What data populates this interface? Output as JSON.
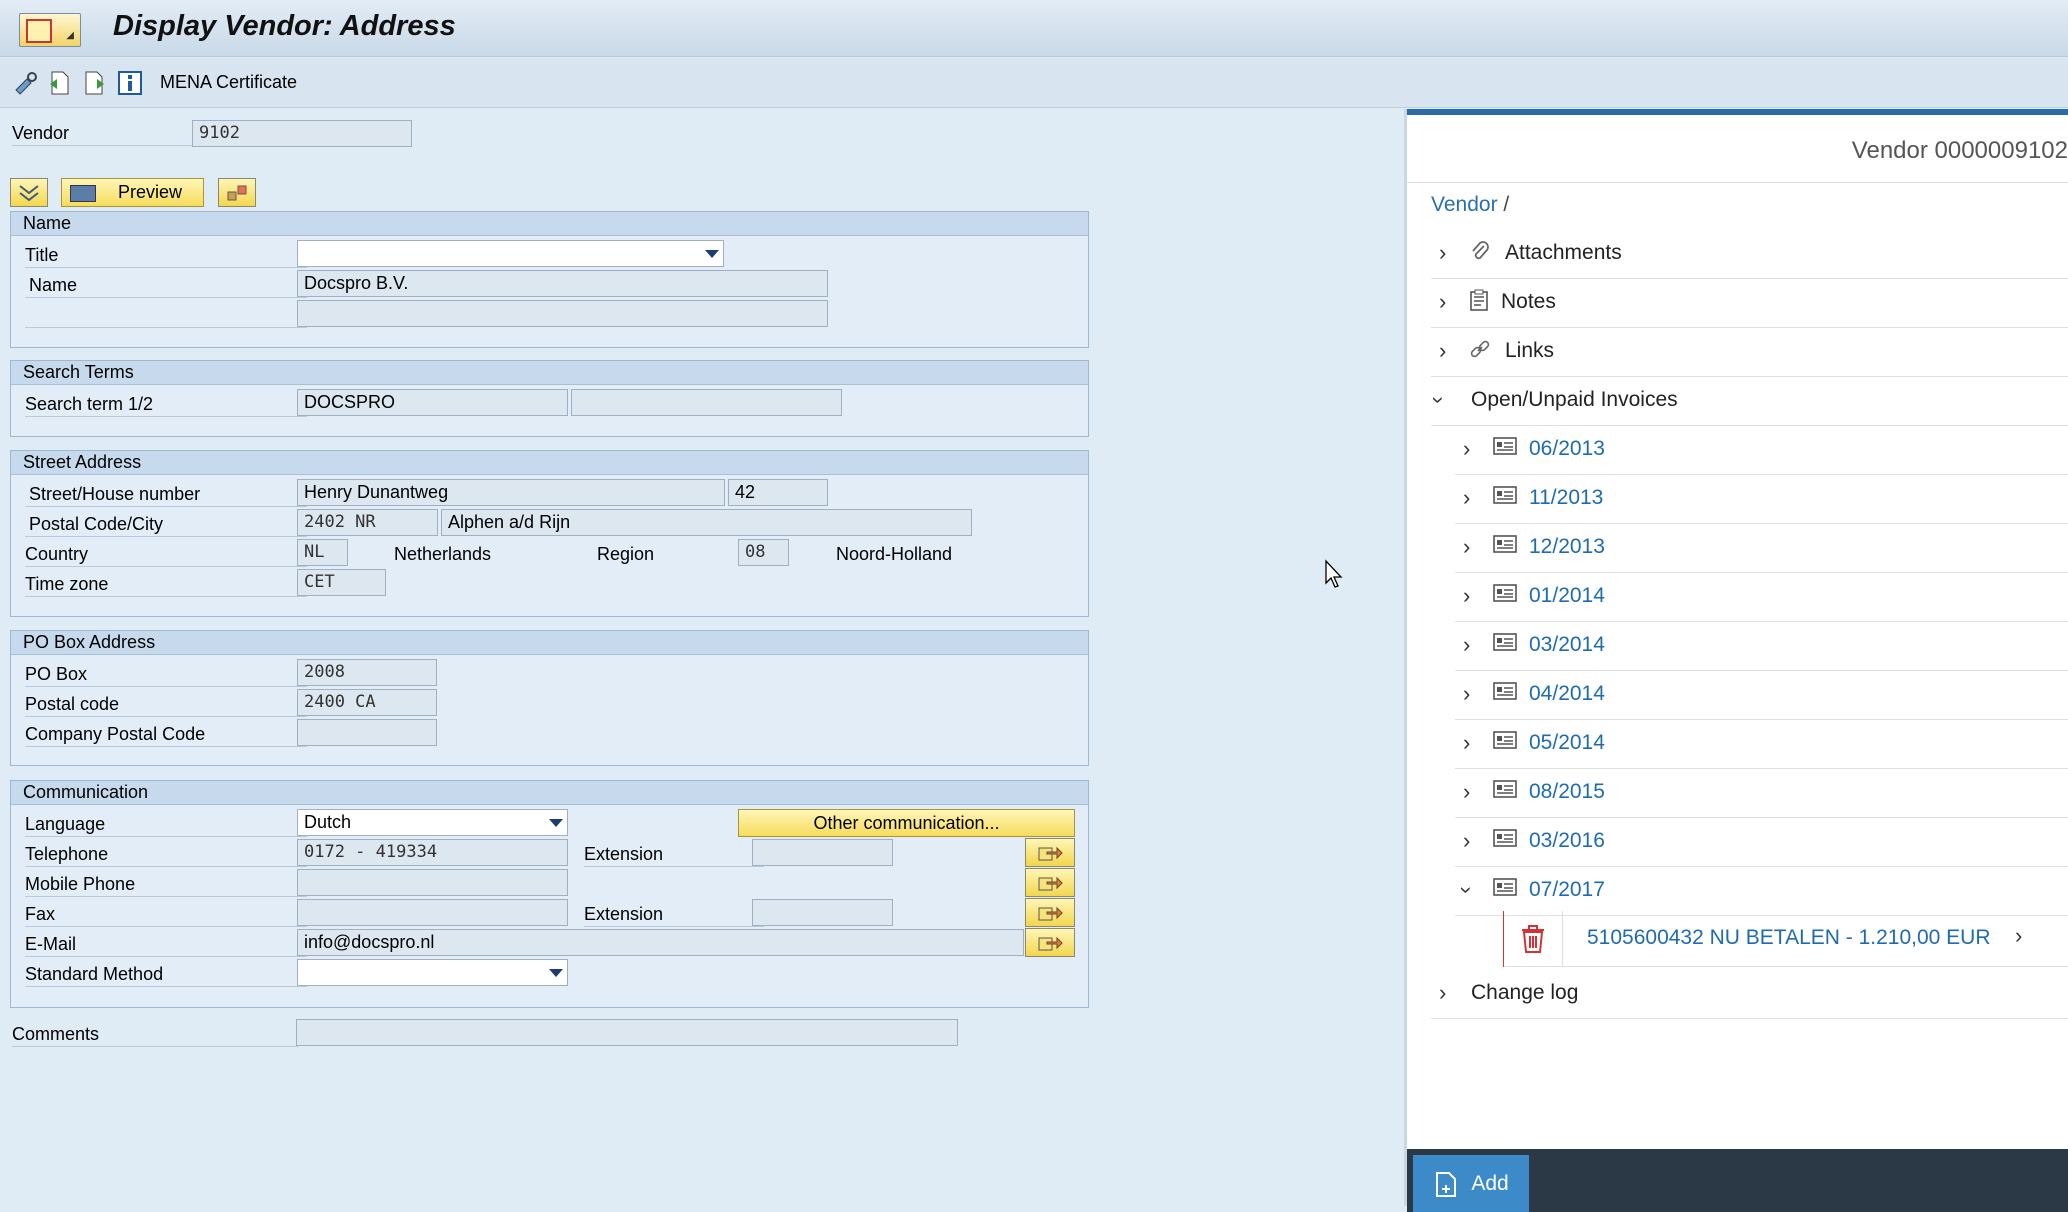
{
  "window": {
    "title": "Display Vendor: Address"
  },
  "toolbar": {
    "mena_label": "MENA Certificate"
  },
  "vendor": {
    "label": "Vendor",
    "value": "9102"
  },
  "actions": {
    "preview_label": "Preview"
  },
  "name_group": {
    "header": "Name",
    "title_label": "Title",
    "title_value": "",
    "name_label": "Name",
    "name_value": "Docspro B.V.",
    "name2_value": ""
  },
  "search_group": {
    "header": "Search Terms",
    "label": "Search term 1/2",
    "term1": "DOCSPRO",
    "term2": ""
  },
  "street_group": {
    "header": "Street Address",
    "street_label": "Street/House number",
    "street": "Henry Dunantweg",
    "house": "42",
    "postal_label": "Postal Code/City",
    "postal": "2402 NR",
    "city": "Alphen a/d Rijn",
    "country_label": "Country",
    "country_code": "NL",
    "country_name": "Netherlands",
    "region_label": "Region",
    "region_code": "08",
    "region_name": "Noord-Holland",
    "tz_label": "Time zone",
    "tz": "CET"
  },
  "pobox_group": {
    "header": "PO Box Address",
    "pobox_label": "PO Box",
    "pobox": "2008",
    "postal_label": "Postal code",
    "postal": "2400 CA",
    "company_label": "Company Postal Code",
    "company": ""
  },
  "comm_group": {
    "header": "Communication",
    "language_label": "Language",
    "language": "Dutch",
    "other_button": "Other communication...",
    "phone_label": "Telephone",
    "phone": "0172 - 419334",
    "ext_label": "Extension",
    "phone_ext": "",
    "mobile_label": "Mobile Phone",
    "mobile": "",
    "fax_label": "Fax",
    "fax": "",
    "fax_ext_label": "Extension",
    "fax_ext": "",
    "email_label": "E-Mail",
    "email": "info@docspro.nl",
    "method_label": "Standard Method",
    "method": ""
  },
  "comments": {
    "label": "Comments",
    "value": ""
  },
  "side_panel": {
    "header": "Vendor 0000009102",
    "breadcrumb": "Vendor",
    "breadcrumb_sep": "/",
    "sections": {
      "attachments": "Attachments",
      "notes": "Notes",
      "links": "Links",
      "invoices": "Open/Unpaid Invoices",
      "changelog": "Change log"
    },
    "invoice_periods": [
      "06/2013",
      "11/2013",
      "12/2013",
      "01/2014",
      "03/2014",
      "04/2014",
      "05/2014",
      "08/2015",
      "03/2016",
      "07/2017"
    ],
    "open_item": "5105600432 NU BETALEN - 1.210,00 EUR",
    "add_label": "Add"
  },
  "colors": {
    "accent": "#2b6aa8",
    "link": "#1f6bb0",
    "yellow_button": "#f6dc5b",
    "delete": "#d33333"
  }
}
